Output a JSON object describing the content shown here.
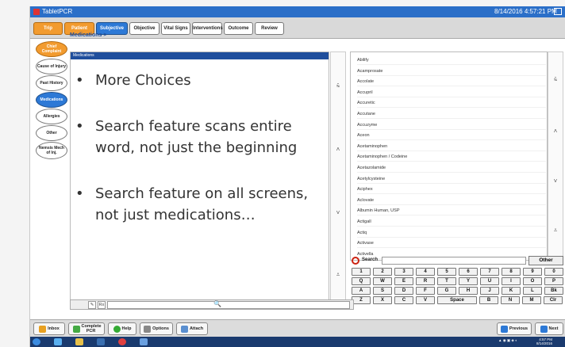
{
  "window": {
    "app_title": "TabletPCR",
    "datetime": "8/14/2016 4:57:21 PM"
  },
  "tabs": [
    {
      "label": "Trip"
    },
    {
      "label": "Patient"
    },
    {
      "label": "Subjective"
    },
    {
      "label": "Objective"
    },
    {
      "label": "Vital Signs"
    },
    {
      "label": "Interventions"
    },
    {
      "label": "Outcome"
    },
    {
      "label": "Review"
    }
  ],
  "breadcrumb": "Medications >",
  "sidebar": {
    "items": [
      {
        "label": "Chief Complaint"
      },
      {
        "label": "Cause of Injury"
      },
      {
        "label": "Past History"
      },
      {
        "label": "Medications"
      },
      {
        "label": "Allergies"
      },
      {
        "label": "Other"
      },
      {
        "label": "Nemsis Mech of Inj."
      }
    ]
  },
  "panel": {
    "header": "Medications",
    "bullets": [
      {
        "line1": "More Choices",
        "line2": ""
      },
      {
        "line1": "Search feature scans entire",
        "line2": "word, not just the beginning"
      },
      {
        "line1": "Search feature on all screens,",
        "line2": "not just medications…"
      }
    ]
  },
  "medications": [
    "Abilify",
    "Acamprosate",
    "Accolate",
    "Accupril",
    "Accuretic",
    "Accutane",
    "Accuzyme",
    "Aceon",
    "Acetaminophen",
    "Acetaminophen / Codeine",
    "Acetazolamide",
    "Acetylcysteine",
    "Aciphex",
    "Aclovate",
    "Albumin Human, USP",
    "Actigall",
    "Actiq",
    "Activase",
    "Activella"
  ],
  "search": {
    "label": "Search",
    "value": "",
    "other_label": "Other"
  },
  "keyboard": {
    "rows": [
      [
        "1",
        "2",
        "3",
        "4",
        "5",
        "6",
        "7",
        "8",
        "9",
        "0"
      ],
      [
        "Q",
        "W",
        "E",
        "R",
        "T",
        "Y",
        "U",
        "I",
        "O",
        "P"
      ],
      [
        "A",
        "S",
        "D",
        "F",
        "G",
        "H",
        "J",
        "K",
        "L",
        "Bk"
      ],
      [
        "Z",
        "X",
        "C",
        "V",
        "Space",
        "B",
        "N",
        "M",
        "Clr"
      ]
    ]
  },
  "notebar": {
    "rx_label": "Rx"
  },
  "bottom_toolbar": {
    "inbox": "Inbox",
    "complete_pcr": "Complete PCR",
    "help": "Help",
    "options": "Options",
    "attach": "Attach",
    "previous": "Previous",
    "next": "Next"
  },
  "taskbar": {
    "time": "4:57 PM",
    "date": "8/14/2016"
  },
  "colors": {
    "accent_blue": "#2d79d6",
    "accent_orange": "#f29b2f",
    "title_blue": "#2b6fc8",
    "panel_header": "#1f4e9c"
  },
  "icons": {
    "scroll_top": "double-up-arrow",
    "scroll_up": "up-arrow",
    "scroll_down": "down-arrow",
    "scroll_bottom": "double-down-arrow",
    "no_entry": "no-entry-icon",
    "search": "magnifier-icon"
  }
}
